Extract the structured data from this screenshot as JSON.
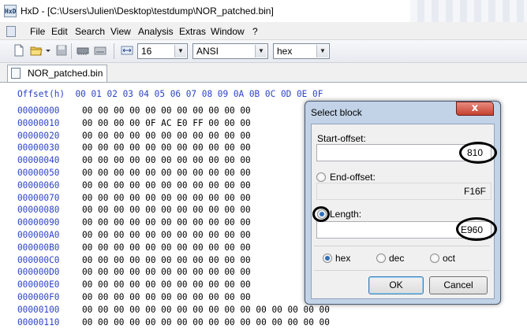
{
  "window": {
    "title": "HxD - [C:\\Users\\Julien\\Desktop\\testdump\\NOR_patched.bin]",
    "app_icon_text": "HxD"
  },
  "menu": [
    "File",
    "Edit",
    "Search",
    "View",
    "Analysis",
    "Extras",
    "Window",
    "?"
  ],
  "toolbar": {
    "bytes_per_row": "16",
    "charset": "ANSI",
    "offset_base": "hex"
  },
  "tab": {
    "label": "NOR_patched.bin"
  },
  "hex": {
    "header": "Offset(h)  00 01 02 03 04 05 06 07 08 09 0A 0B 0C 0D 0E 0F",
    "offsets": [
      "00000000",
      "00000010",
      "00000020",
      "00000030",
      "00000040",
      "00000050",
      "00000060",
      "00000070",
      "00000080",
      "00000090",
      "000000A0",
      "000000B0",
      "000000C0",
      "000000D0",
      "000000E0",
      "000000F0",
      "00000100",
      "00000110"
    ],
    "rows": [
      "00 00 00 00 00 00 00 00 00 00 00",
      "00 00 00 00 0F AC E0 FF 00 00 00",
      "00 00 00 00 00 00 00 00 00 00 00",
      "00 00 00 00 00 00 00 00 00 00 00",
      "00 00 00 00 00 00 00 00 00 00 00",
      "00 00 00 00 00 00 00 00 00 00 00",
      "00 00 00 00 00 00 00 00 00 00 00",
      "00 00 00 00 00 00 00 00 00 00 00",
      "00 00 00 00 00 00 00 00 00 00 00",
      "00 00 00 00 00 00 00 00 00 00 00",
      "00 00 00 00 00 00 00 00 00 00 00",
      "00 00 00 00 00 00 00 00 00 00 00",
      "00 00 00 00 00 00 00 00 00 00 00",
      "00 00 00 00 00 00 00 00 00 00 00",
      "00 00 00 00 00 00 00 00 00 00 00",
      "00 00 00 00 00 00 00 00 00 00 00",
      "00 00 00 00 00 00 00 00 00 00 00 00 00 00 00 00",
      "00 00 00 00 00 00 00 00 00 00 00 00 00 00 00 00"
    ],
    "ascii_rows": [
      "",
      "",
      "",
      "",
      "",
      "",
      "",
      "",
      "",
      "",
      "",
      "",
      "",
      "",
      "",
      "",
      "................",
      "................"
    ]
  },
  "dialog": {
    "title": "Select block",
    "close_glyph": "x",
    "start_offset_label": "Start-offset:",
    "start_offset_value": "810",
    "end_offset_label": "End-offset:",
    "end_offset_value": "F16F",
    "length_label": "Length:",
    "length_value": "E960",
    "bases": [
      "hex",
      "dec",
      "oct"
    ],
    "selected_base": "hex",
    "ok_label": "OK",
    "cancel_label": "Cancel"
  },
  "colors": {
    "offset_blue": "#2b43c7",
    "dialog_frame": "#c2d3e7",
    "close_red": "#c5412f"
  }
}
